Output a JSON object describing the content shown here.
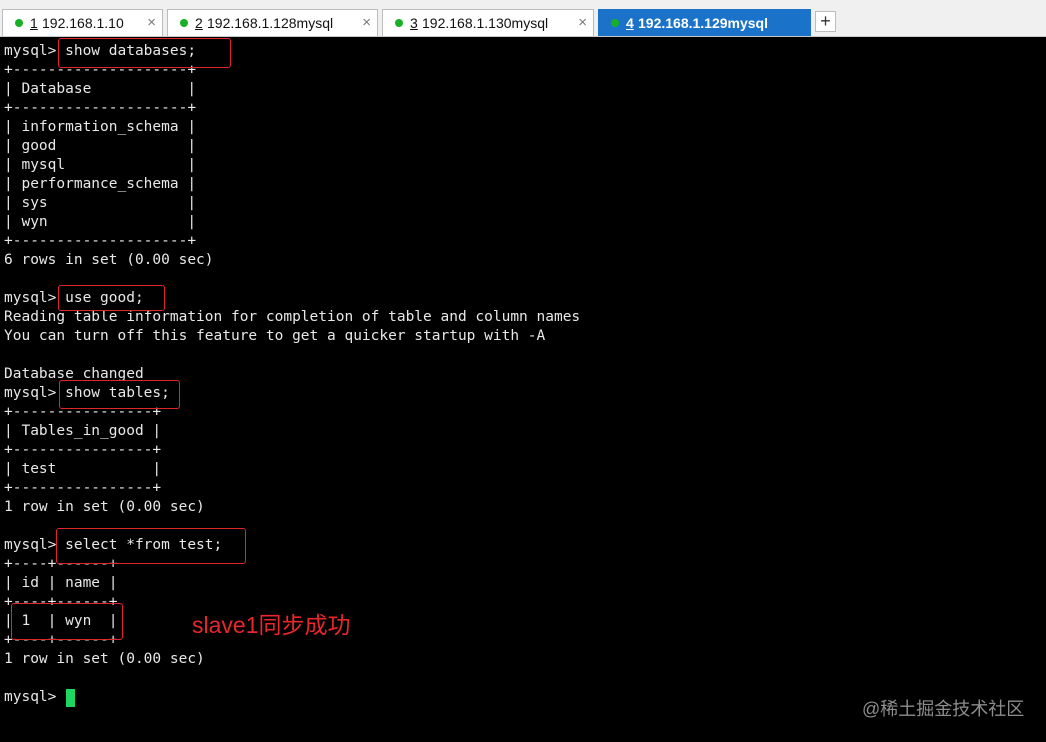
{
  "tabs": [
    {
      "num": "1",
      "label": "192.168.1.10",
      "close": "×"
    },
    {
      "num": "2",
      "label": "192.168.1.128mysql",
      "close": "×"
    },
    {
      "num": "3",
      "label": "192.168.1.130mysql",
      "close": "×"
    },
    {
      "num": "4",
      "label": "192.168.1.129mysql",
      "close": ""
    }
  ],
  "add_tab": "+",
  "terminal_lines": [
    "mysql> show databases;",
    "+--------------------+",
    "| Database           |",
    "+--------------------+",
    "| information_schema |",
    "| good               |",
    "| mysql              |",
    "| performance_schema |",
    "| sys                |",
    "| wyn                |",
    "+--------------------+",
    "6 rows in set (0.00 sec)",
    "",
    "mysql> use good;",
    "Reading table information for completion of table and column names",
    "You can turn off this feature to get a quicker startup with -A",
    "",
    "Database changed",
    "mysql> show tables;",
    "+----------------+",
    "| Tables_in_good |",
    "+----------------+",
    "| test           |",
    "+----------------+",
    "1 row in set (0.00 sec)",
    "",
    "mysql> select *from test;",
    "+----+------+",
    "| id | name |",
    "+----+------+",
    "| 1  | wyn  |",
    "+----+------+",
    "1 row in set (0.00 sec)",
    "",
    "mysql> "
  ],
  "annotation": "slave1同步成功",
  "watermark": "@稀土掘金技术社区",
  "colors": {
    "accent": "#1a73c8",
    "annotation": "#e8262c",
    "cursor": "#1ed760",
    "status_dot": "#17b026"
  }
}
